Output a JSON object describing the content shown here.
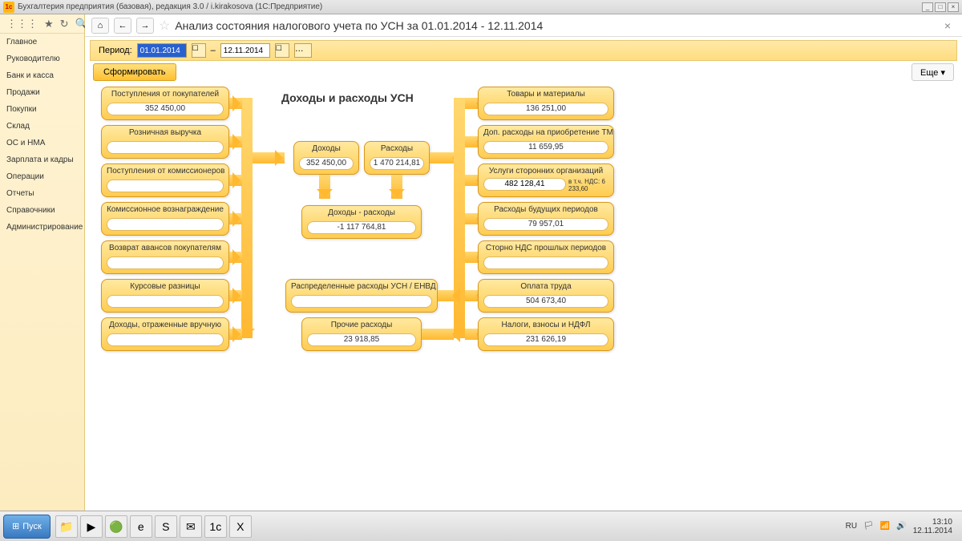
{
  "window": {
    "title": "Бухгалтерия предприятия (базовая), редакция 3.0 / i.kirakosova  (1С:Предприятие)"
  },
  "sidebar": {
    "items": [
      {
        "label": "Главное"
      },
      {
        "label": "Руководителю"
      },
      {
        "label": "Банк и касса"
      },
      {
        "label": "Продажи"
      },
      {
        "label": "Покупки"
      },
      {
        "label": "Склад"
      },
      {
        "label": "ОС и НМА"
      },
      {
        "label": "Зарплата и кадры"
      },
      {
        "label": "Операции"
      },
      {
        "label": "Отчеты"
      },
      {
        "label": "Справочники"
      },
      {
        "label": "Администрирование"
      }
    ]
  },
  "header": {
    "title": "Анализ состояния налогового учета по УСН за 01.01.2014 - 12.11.2014"
  },
  "period": {
    "label": "Период:",
    "from": "01.01.2014",
    "to": "12.11.2014",
    "dash": "–"
  },
  "actions": {
    "form": "Сформировать",
    "more": "Еще",
    "more_arrow": "▾"
  },
  "diagram": {
    "title": "Доходы и расходы УСН",
    "left": [
      {
        "label": "Поступления от покупателей",
        "value": "352 450,00"
      },
      {
        "label": "Розничная выручка",
        "value": ""
      },
      {
        "label": "Поступления от комиссионеров",
        "value": ""
      },
      {
        "label": "Комиссионное вознаграждение",
        "value": ""
      },
      {
        "label": "Возврат авансов покупателям",
        "value": ""
      },
      {
        "label": "Курсовые разницы",
        "value": ""
      },
      {
        "label": "Доходы, отраженные вручную",
        "value": ""
      }
    ],
    "center": {
      "income": {
        "label": "Доходы",
        "value": "352 450,00"
      },
      "expense": {
        "label": "Расходы",
        "value": "1 470 214,81"
      },
      "diff": {
        "label": "Доходы - расходы",
        "value": "-1 117 764,81"
      },
      "dist": {
        "label": "Распределенные расходы УСН / ЕНВД",
        "value": ""
      },
      "other": {
        "label": "Прочие расходы",
        "value": "23 918,85"
      }
    },
    "right": [
      {
        "label": "Товары и материалы",
        "value": "136 251,00"
      },
      {
        "label": "Доп. расходы на приобретение ТМЦ",
        "value": "11 659,95"
      },
      {
        "label": "Услуги сторонних организаций",
        "value": "482 128,41",
        "note": "в т.ч. НДС: 6 233,60"
      },
      {
        "label": "Расходы будущих периодов",
        "value": "79 957,01"
      },
      {
        "label": "Сторно НДС прошлых периодов",
        "value": ""
      },
      {
        "label": "Оплата труда",
        "value": "504 673,40"
      },
      {
        "label": "Налоги, взносы и НДФЛ",
        "value": "231 626,19"
      }
    ]
  },
  "taskbar": {
    "start": "Пуск",
    "tray_lang": "RU",
    "clock": {
      "time": "13:10",
      "date": "12.11.2014"
    }
  }
}
